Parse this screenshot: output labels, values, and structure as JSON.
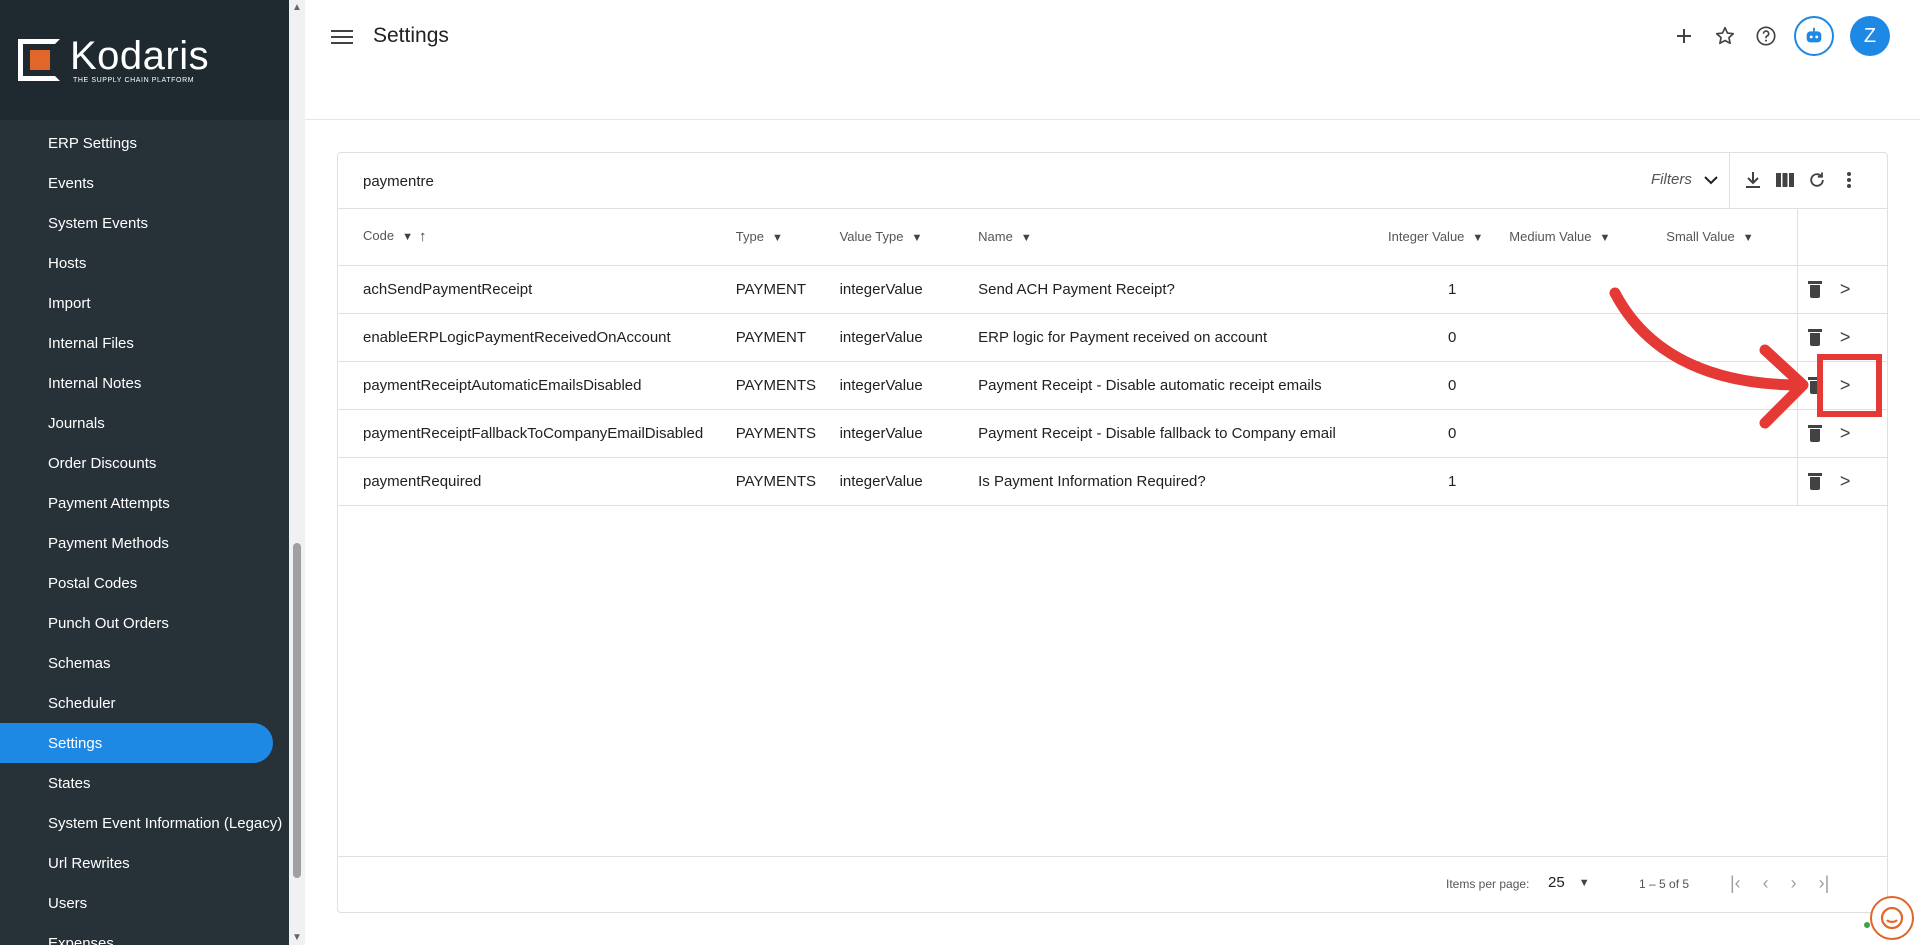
{
  "app": {
    "logo_name": "Kodaris",
    "logo_tagline": "THE SUPPLY CHAIN PLATFORM",
    "brand_color": "#1e88e5",
    "accent_color": "#e0662a",
    "sidebar_color": "#263238"
  },
  "sidebar": {
    "items": [
      {
        "label": "ERP Settings"
      },
      {
        "label": "Events"
      },
      {
        "label": "System Events"
      },
      {
        "label": "Hosts"
      },
      {
        "label": "Import"
      },
      {
        "label": "Internal Files"
      },
      {
        "label": "Internal Notes"
      },
      {
        "label": "Journals"
      },
      {
        "label": "Order Discounts"
      },
      {
        "label": "Payment Attempts"
      },
      {
        "label": "Payment Methods"
      },
      {
        "label": "Postal Codes"
      },
      {
        "label": "Punch Out Orders"
      },
      {
        "label": "Schemas"
      },
      {
        "label": "Scheduler"
      },
      {
        "label": "Settings",
        "active": true
      },
      {
        "label": "States"
      },
      {
        "label": "System Event Information (Legacy)"
      },
      {
        "label": "Url Rewrites"
      },
      {
        "label": "Users"
      },
      {
        "label": "Expenses"
      }
    ]
  },
  "header": {
    "title": "Settings",
    "avatar_initial": "Z"
  },
  "toolbar": {
    "search_value": "paymentre",
    "filters_label": "Filters"
  },
  "table": {
    "columns": [
      "Code",
      "Type",
      "Value Type",
      "Name",
      "Integer Value",
      "Medium Value",
      "Small Value"
    ],
    "rows": [
      {
        "code": "achSendPaymentReceipt",
        "type": "PAYMENT",
        "value_type": "integerValue",
        "name": "Send ACH Payment Receipt?",
        "integer_value": "1",
        "medium_value": "",
        "small_value": ""
      },
      {
        "code": "enableERPLogicPaymentReceivedOnAccount",
        "type": "PAYMENT",
        "value_type": "integerValue",
        "name": "ERP logic for Payment received on account",
        "integer_value": "0",
        "medium_value": "",
        "small_value": ""
      },
      {
        "code": "paymentReceiptAutomaticEmailsDisabled",
        "type": "PAYMENTS",
        "value_type": "integerValue",
        "name": "Payment Receipt - Disable automatic receipt emails",
        "integer_value": "0",
        "medium_value": "",
        "small_value": ""
      },
      {
        "code": "paymentReceiptFallbackToCompanyEmailDisabled",
        "type": "PAYMENTS",
        "value_type": "integerValue",
        "name": "Payment Receipt - Disable fallback to Company email",
        "integer_value": "0",
        "medium_value": "",
        "small_value": ""
      },
      {
        "code": "paymentRequired",
        "type": "PAYMENTS",
        "value_type": "integerValue",
        "name": "Is Payment Information Required?",
        "integer_value": "1",
        "medium_value": "",
        "small_value": ""
      }
    ]
  },
  "footer": {
    "items_per_page_label": "Items per page:",
    "items_per_page_value": "25",
    "range_label": "1 – 5 of 5"
  },
  "annotation": {
    "color": "#e53935",
    "highlighted_row": 2
  }
}
